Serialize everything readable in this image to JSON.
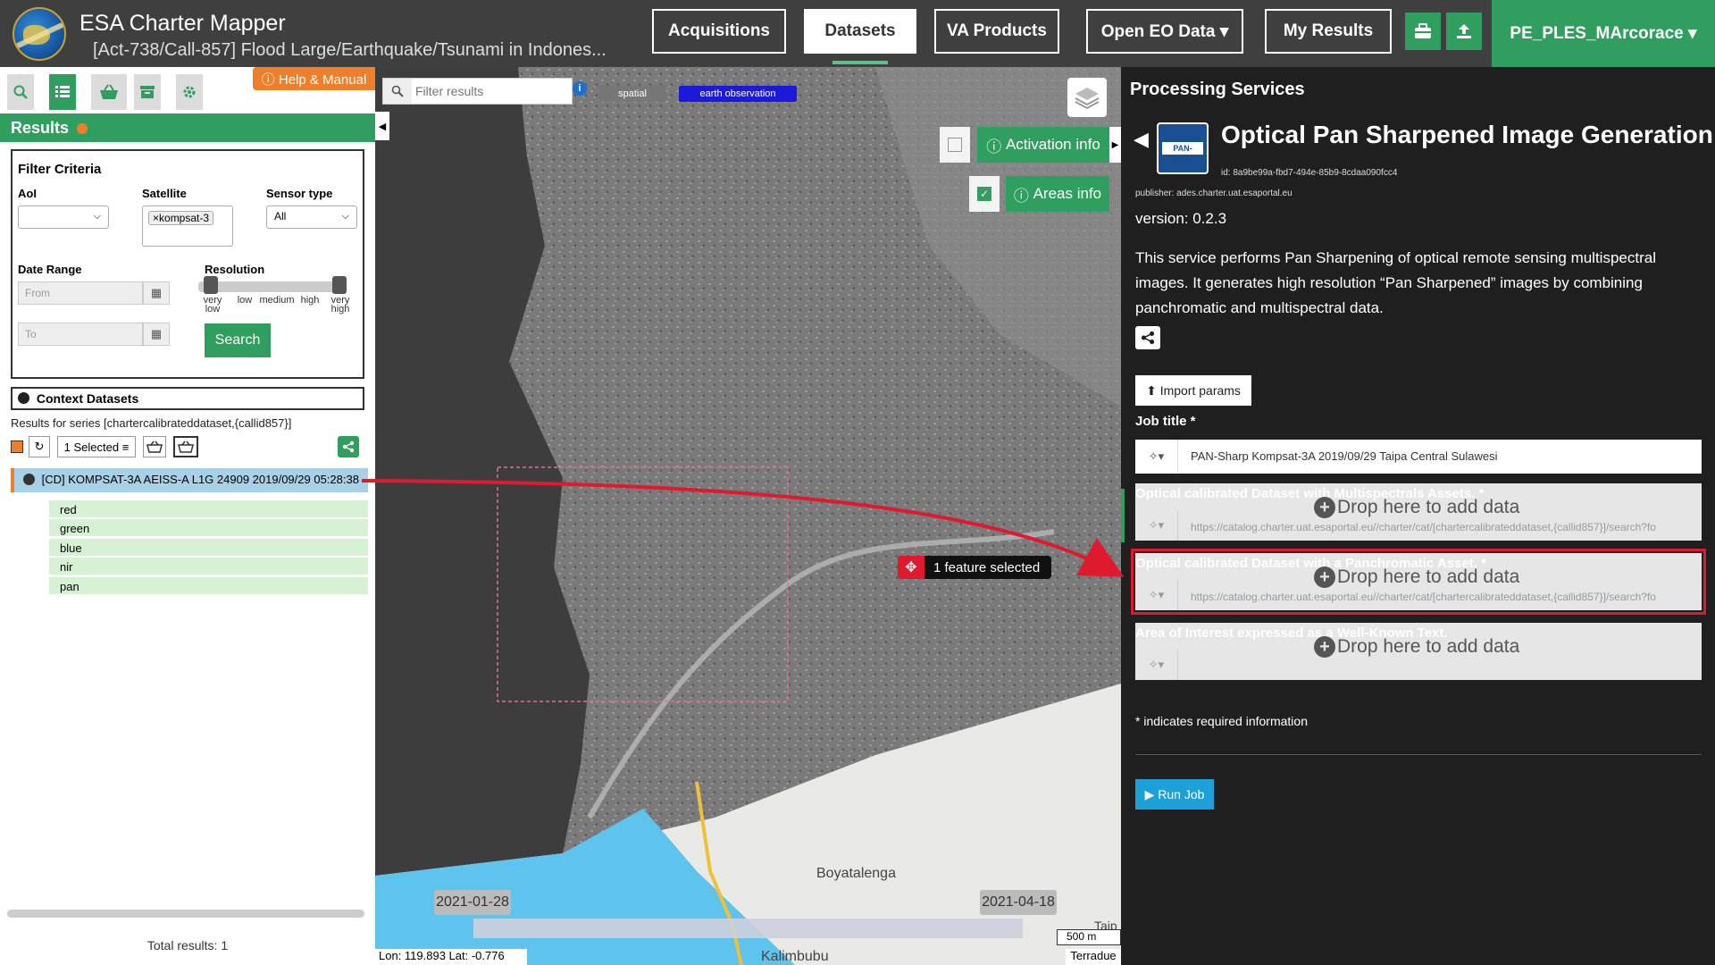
{
  "app": {
    "title": "ESA Charter Mapper",
    "activation": "[Act-738/Call-857] Flood Large/Earthquake/Tsunami in Indones..."
  },
  "topnav": {
    "tabs": [
      {
        "label": "Acquisitions"
      },
      {
        "label": "Datasets"
      },
      {
        "label": "VA Products"
      },
      {
        "label": "Open EO Data ▾"
      },
      {
        "label": "My Results"
      }
    ],
    "user": "PE_PLES_MArcorace ▾",
    "icons": [
      "briefcase-icon",
      "upload-icon"
    ]
  },
  "left": {
    "help": "ⓘ Help & Manual",
    "results_header": "Results",
    "filter": {
      "title": "Filter Criteria",
      "aoi_label": "AoI",
      "satellite_label": "Satellite",
      "satellite_tag": "kompsat-3",
      "sensor_label": "Sensor type",
      "sensor_value": "All",
      "date_label": "Date Range",
      "from_placeholder": "From",
      "to_placeholder": "To",
      "resolution_label": "Resolution",
      "resolution_ticks": [
        "very low",
        "low",
        "medium",
        "high",
        "very high"
      ],
      "search_label": "Search"
    },
    "context_title": "Context Datasets",
    "series_text": "Results for series [chartercalibrateddataset,{callid857}]",
    "selected_label": "1 Selected",
    "result_item": "[CD] KOMPSAT-3A AEISS-A L1G 24909 2019/09/29 05:28:38",
    "assets": [
      "red",
      "green",
      "blue",
      "nir",
      "pan"
    ],
    "total": "Total results: 1"
  },
  "map": {
    "filter_placeholder": "Filter results",
    "tag_spatial": "spatial",
    "tag_eo": "earth observation",
    "activation_info": "Activation info",
    "areas_info": "Areas info",
    "feature_selected": "1 feature selected",
    "place1": "Boyatalenga",
    "place2": "Kalimbubu",
    "place3": "Taip",
    "date_start": "2021-01-28",
    "date_end": "2021-04-18",
    "scale": "500 m",
    "coords": "Lon: 119.893 Lat: -0.776",
    "attribution": "Terradue"
  },
  "right": {
    "panel_title": "Processing Services",
    "service_logo_text": "PAN-Sharp",
    "service_name": "Optical Pan Sharpened Image Generation",
    "service_id": "id: 8a9be99a-fbd7-494e-85b9-8cdaa090fcc4",
    "publisher": "publisher: ades.charter.uat.esaportal.eu",
    "version": "version: 0.2.3",
    "description": "This service performs Pan Sharpening of optical remote sensing multispectral images. It generates high resolution “Pan Sharpened” images by combining panchromatic and multispectral data.",
    "import_label": "Import params",
    "job_title_label": "Job title *",
    "job_title_value": "PAN-Sharp Kompsat-3A 2019/09/29 Taipa Central Sulawesi",
    "drop_text": "Drop here to add data",
    "fields": [
      {
        "title": "Optical calibrated Dataset with Multispectrals Assets. *",
        "url": "https://catalog.charter.uat.esaportal.eu//charter/cat/[chartercalibrateddataset,{callid857}]/search?fo"
      },
      {
        "title": "Optical calibrated Dataset with a Panchromatic Asset. *",
        "url": "https://catalog.charter.uat.esaportal.eu//charter/cat/[chartercalibrateddataset,{callid857}]/search?fo"
      },
      {
        "title": "Area of Interest expressed as a Well-Known Text.",
        "url": ""
      }
    ],
    "required_note": "* indicates required information",
    "run_label": "Run Job"
  }
}
